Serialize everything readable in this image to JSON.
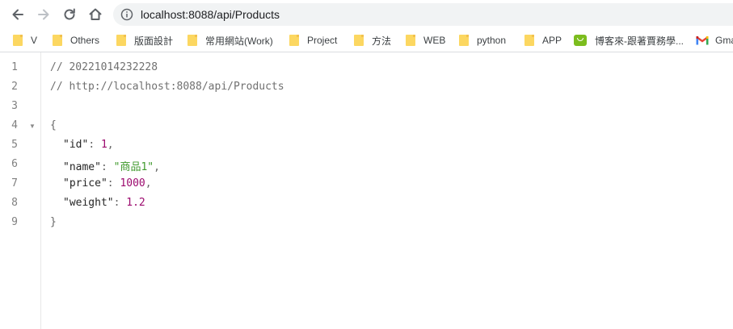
{
  "browser": {
    "url": "localhost:8088/api/Products",
    "bookmarks": [
      {
        "label": "V",
        "icon": "folder-icon"
      },
      {
        "label": "Others",
        "icon": "folder-icon"
      },
      {
        "label": "版面設計",
        "icon": "folder-icon"
      },
      {
        "label": "常用網站(Work)",
        "icon": "folder-icon"
      },
      {
        "label": "Project",
        "icon": "folder-icon"
      },
      {
        "label": "方法",
        "icon": "folder-icon"
      },
      {
        "label": "WEB",
        "icon": "folder-icon"
      },
      {
        "label": "python",
        "icon": "folder-icon"
      },
      {
        "label": "APP",
        "icon": "folder-icon"
      },
      {
        "label": "博客來-跟著賈務學...",
        "icon": "shop-icon"
      },
      {
        "label": "Gma",
        "icon": "gmail-icon"
      }
    ]
  },
  "json_view": {
    "line_numbers": [
      "1",
      "2",
      "3",
      "4",
      "5",
      "6",
      "7",
      "8",
      "9"
    ],
    "comment_timestamp": "// 20221014232228",
    "comment_url": "// http://localhost:8088/api/Products",
    "open_brace": "{",
    "close_brace": "}",
    "fields": [
      {
        "key": "\"id\"",
        "sep": ": ",
        "value": "1",
        "type": "number",
        "comma": ","
      },
      {
        "key": "\"name\"",
        "sep": ": ",
        "value": "\"商品1\"",
        "type": "string",
        "comma": ","
      },
      {
        "key": "\"price\"",
        "sep": ": ",
        "value": "1000",
        "type": "number",
        "comma": ","
      },
      {
        "key": "\"weight\"",
        "sep": ": ",
        "value": "1.2",
        "type": "number",
        "comma": ""
      }
    ]
  }
}
